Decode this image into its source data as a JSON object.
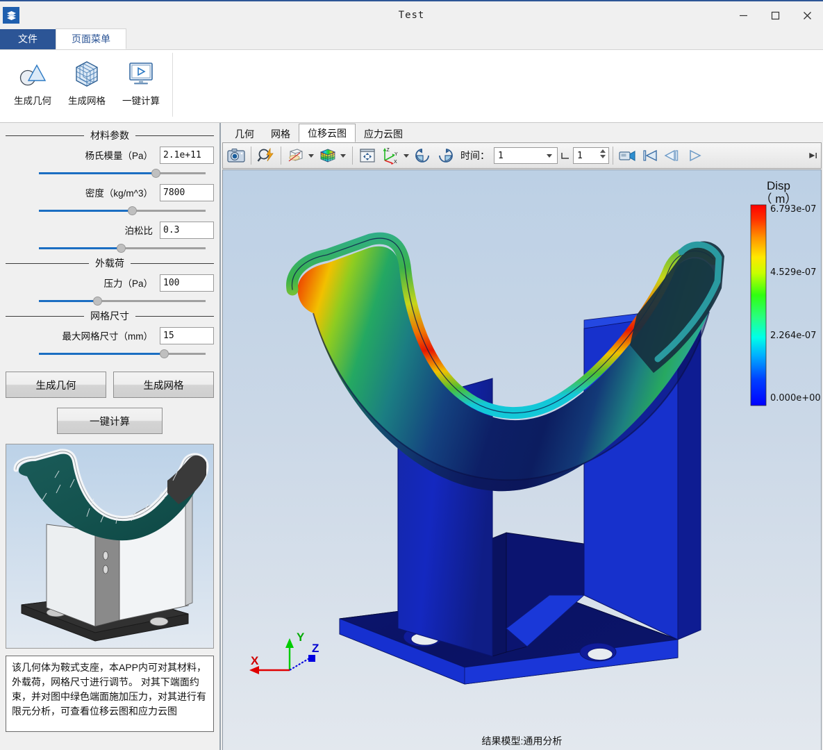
{
  "window": {
    "title": "Test",
    "app_icon": "layers-icon",
    "minimize": "—",
    "maximize": "☐",
    "close": "✕"
  },
  "ribbon": {
    "tabs": [
      {
        "label": "文件",
        "kind": "file"
      },
      {
        "label": "页面菜单",
        "kind": "active"
      }
    ],
    "items": [
      {
        "label": "生成几何",
        "icon": "geometry-icon"
      },
      {
        "label": "生成网格",
        "icon": "mesh-cube-icon"
      },
      {
        "label": "一键计算",
        "icon": "run-monitor-icon"
      }
    ]
  },
  "sidebar": {
    "groups": [
      {
        "title": "材料参数",
        "params": [
          {
            "label": "杨氏模量（Pa）",
            "value": "2.1e+11",
            "slider": 70
          },
          {
            "label": "密度（kg/m^3）",
            "value": "7800",
            "slider": 56
          },
          {
            "label": "泊松比",
            "value": "0.3",
            "slider": 49
          }
        ]
      },
      {
        "title": "外载荷",
        "params": [
          {
            "label": "压力（Pa）",
            "value": "100",
            "slider": 35
          }
        ]
      },
      {
        "title": "网格尺寸",
        "params": [
          {
            "label": "最大网格尺寸（mm）",
            "value": "15",
            "slider": 75
          }
        ]
      }
    ],
    "buttons": {
      "generate_geometry": "生成几何",
      "generate_mesh": "生成网格",
      "one_click_compute": "一键计算"
    },
    "preview_alt": "saddle-support-cad-preview",
    "description": "该几何体为鞍式支座，本APP内可对其材料，外载荷，网格尺寸进行调节。\n对其下端面约束，并对图中绿色端面施加压力，对其进行有限元分析，可查看位移云图和应力云图"
  },
  "viewer": {
    "tabs": [
      {
        "label": "几何",
        "active": false
      },
      {
        "label": "网格",
        "active": false
      },
      {
        "label": "位移云图",
        "active": true
      },
      {
        "label": "应力云图",
        "active": false
      }
    ],
    "toolbar": {
      "screenshot": "camera-icon",
      "zoom": "magnifier-lightning-icon",
      "clip": "cube-clip-icon",
      "colormap": "rainbow-cube-icon",
      "fit": "fit-to-window-icon",
      "axes": "axes-triad-icon",
      "rotate_cw": "rotate-cw-icon",
      "rotate_ccw": "rotate-ccw-icon",
      "time_label": "时间：",
      "time_value": "1",
      "step_value": "1",
      "record": "video-record-icon",
      "skip_start": "skip-to-start-icon",
      "step_back": "step-back-icon",
      "play": "play-icon",
      "skip_end": "skip-to-end-icon"
    },
    "status": "结果模型:通用分析",
    "axes": {
      "x": "X",
      "y": "Y",
      "z": "Z"
    },
    "colorbar": {
      "title": "Disp",
      "unit": "（ m）",
      "max": "6.793e-07",
      "mid_high": "4.529e-07",
      "mid_low": "2.264e-07",
      "min": "0.000e+00"
    }
  },
  "chart_data": {
    "type": "heatmap",
    "title": "Disp ( m )",
    "legend_position": "right",
    "colormap": "jet",
    "ticks": [
      "0.000e+00",
      "2.264e-07",
      "4.529e-07",
      "6.793e-07"
    ],
    "range": [
      0,
      6.793e-07
    ],
    "unit": "m",
    "field": "Displacement magnitude",
    "model": "结果模型:通用分析"
  },
  "colors": {
    "accent": "#2c5596",
    "slider_fill": "#1b6ec2",
    "viewport_top": "#bcd0e5",
    "viewport_bottom": "#e3e8ee"
  }
}
